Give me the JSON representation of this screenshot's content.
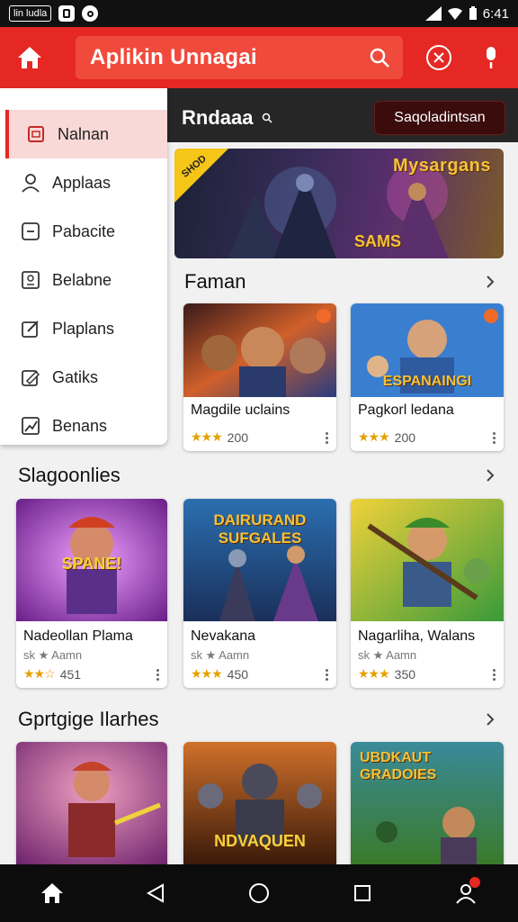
{
  "status_bar": {
    "carrier_logo": "lin ludla",
    "time": "6:41"
  },
  "app_bar": {
    "title": "Aplikin Unnagai"
  },
  "top_strip": {
    "heading": "Rndaaa",
    "button_label": "Saqoladintsan"
  },
  "drawer": {
    "items": [
      {
        "label": "Nalnan",
        "icon": "document-icon"
      },
      {
        "label": "Applaas",
        "icon": "person-icon"
      },
      {
        "label": "Pabacite",
        "icon": "card-icon"
      },
      {
        "label": "Belabne",
        "icon": "profile-box-icon"
      },
      {
        "label": "Plaplans",
        "icon": "edit-icon"
      },
      {
        "label": "Gatiks",
        "icon": "pencil-icon"
      },
      {
        "label": "Benans",
        "icon": "chart-icon"
      }
    ]
  },
  "banner": {
    "badge": "SHOD",
    "title": "Mysargans",
    "subtitle": "SAMS"
  },
  "sections": [
    {
      "heading": "Faman",
      "cards": [
        {
          "title": "Magdile uclains",
          "rating": "200",
          "art": "#c24a2a"
        },
        {
          "title": "Pagkorl ledana",
          "rating": "200",
          "art": "#3a7fcf",
          "caption": "ESPANAINGI"
        }
      ]
    },
    {
      "heading": "Slagoonlies",
      "cards": [
        {
          "title": "Nadeollan Plama",
          "subtitle": "sk ★ Aamn",
          "rating": "451",
          "art": "#9b3fb8",
          "caption": "SPANE!"
        },
        {
          "title": "Nevakana",
          "subtitle": "sk ★ Aamn",
          "rating": "450",
          "art": "#2b6fb0",
          "caption": "DAIRURAND SUFGALES"
        },
        {
          "title": "Nagarliha, Walans",
          "subtitle": "sk ★ Aamn",
          "rating": "350",
          "art": "#6fb23a"
        }
      ]
    },
    {
      "heading": "Gprtgige Ilarhes",
      "cards": [
        {
          "art": "#c4432a"
        },
        {
          "art": "#8a4a18",
          "caption": "NDVAQUEN"
        },
        {
          "art": "#2f7a5a",
          "caption": "UBDKAUT GRADOIES"
        }
      ]
    }
  ]
}
